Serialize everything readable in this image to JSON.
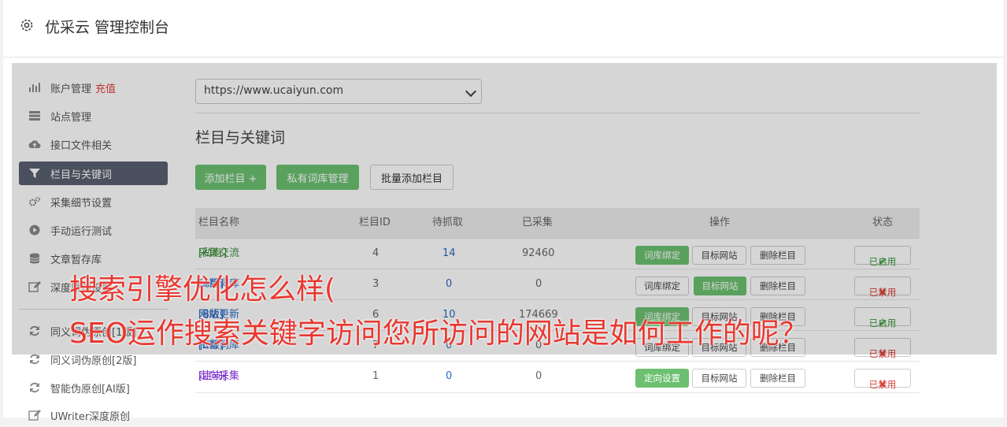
{
  "header": {
    "title": "优采云 管理控制台"
  },
  "sidebar": {
    "items": [
      {
        "label": "账户管理",
        "extra": "充值",
        "icon": "bar-chart-icon"
      },
      {
        "label": "站点管理",
        "icon": "server-icon"
      },
      {
        "label": "接口文件相关",
        "icon": "cloud-upload-icon"
      },
      {
        "label": "栏目与关键词",
        "icon": "filter-icon",
        "active": true
      },
      {
        "label": "采集细节设置",
        "icon": "cogs-icon"
      },
      {
        "label": "手动运行测试",
        "icon": "play-circle-icon"
      },
      {
        "label": "文章暂存库",
        "icon": "database-icon"
      },
      {
        "label": "深度原创设置",
        "icon": "edit-icon"
      },
      {
        "label": "同义词伪原创[1版]",
        "icon": "refresh-icon"
      },
      {
        "label": "同义词伪原创[2版]",
        "icon": "refresh-icon"
      },
      {
        "label": "智能伪原创[AI版]",
        "icon": "refresh-icon"
      },
      {
        "label": "UWriter深度原创",
        "icon": "edit-icon"
      }
    ]
  },
  "main": {
    "site_select": "https://www.ucaiyun.com",
    "section_title": "栏目与关键词",
    "buttons": {
      "add": "添加栏目 +",
      "private_lib": "私有词库管理",
      "batch_add": "批量添加栏目"
    },
    "table": {
      "headers": [
        "栏目名称",
        "栏目ID",
        "待抓取",
        "已采集",
        "操作",
        "状态"
      ],
      "rows": [
        {
          "tag": "[私有]",
          "name": "采集交流",
          "id": "4",
          "pending": "14",
          "collected": "92460",
          "op1": "词库绑定",
          "op2": "目标网站",
          "op3": "删除栏目",
          "status": "已启用"
        },
        {
          "tag": "[A版]",
          "name": "公有词库",
          "id": "3",
          "pending": "0",
          "collected": "0",
          "op1": "词库绑定",
          "op2": "目标网站",
          "op3": "删除栏目",
          "status": "已禁用"
        },
        {
          "tag": "[B版]",
          "name": "网站更新",
          "id": "6",
          "pending": "10",
          "collected": "174669",
          "op1": "词库绑定",
          "op2": "目标网站",
          "op3": "删除栏目",
          "status": "已启用"
        },
        {
          "tag": "[C版]",
          "name": "私有词库",
          "id": "7",
          "pending": "0",
          "collected": "0",
          "op1": "词库绑定",
          "op2": "目标网站",
          "op3": "删除栏目",
          "status": "已禁用"
        },
        {
          "tag": "[定向]",
          "name": "定向采集",
          "id": "1",
          "pending": "0",
          "collected": "0",
          "op1": "定向设置",
          "op2": "目标网站",
          "op3": "删除栏目",
          "status": "已禁用"
        }
      ]
    }
  },
  "overlay": {
    "line1": "搜索引擎优化怎么样(",
    "line2": "SEO运作搜索关键字访问您所访问的网站是如何工作的呢？"
  },
  "colors": {
    "accent_green": "#6cc070",
    "active_bg": "#5a6070",
    "overlay_red": "#e8372f"
  }
}
